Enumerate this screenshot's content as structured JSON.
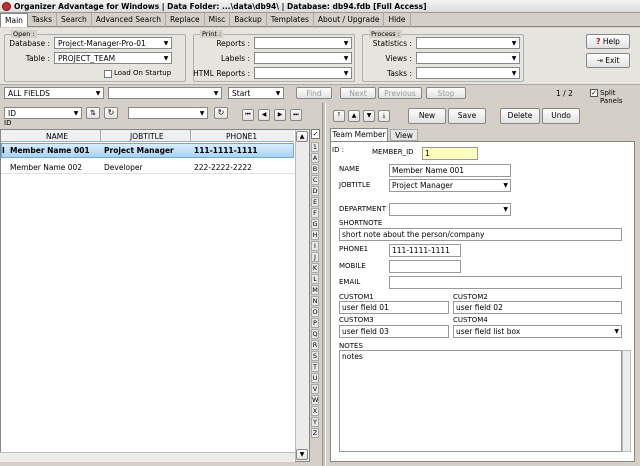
{
  "window": {
    "title": "Organizer Advantage for Windows | Data Folder: ...\\data\\db94\\ | Database: db94.fdb [Full Access]"
  },
  "tabs": [
    "Main",
    "Tasks",
    "Search",
    "Advanced Search",
    "Replace",
    "Misc",
    "Backup",
    "Templates",
    "About / Upgrade",
    "Hide"
  ],
  "open": {
    "group": "Open :",
    "database_label": "Database :",
    "database_value": "Project-Manager-Pro-01",
    "table_label": "Table :",
    "table_value": "PROJECT_TEAM",
    "load_on_startup": "Load On Startup"
  },
  "print": {
    "group": "Print :",
    "reports": "Reports :",
    "labels": "Labels :",
    "html_reports": "HTML Reports :"
  },
  "process": {
    "group": "Process :",
    "statistics": "Statistics :",
    "views": "Views :",
    "tasks": "Tasks :"
  },
  "help": {
    "help": "Help",
    "exit": "Exit"
  },
  "search": {
    "field": "ALL FIELDS",
    "value": "",
    "mode": "Start",
    "find": "Find",
    "next": "Next",
    "previous": "Previous",
    "stop": "Stop",
    "record_count": "1 / 2",
    "split_panels": "Split Panels"
  },
  "sort": {
    "field": "ID",
    "sub": "ID"
  },
  "grid": {
    "columns": [
      "NAME",
      "JOBTITLE",
      "PHONE1"
    ],
    "rows": [
      {
        "name": "Member Name 001",
        "jobtitle": "Project Manager",
        "phone": "111-1111-1111"
      },
      {
        "name": "Member Name 002",
        "jobtitle": "Developer",
        "phone": "222-2222-2222"
      }
    ],
    "indicator": "I"
  },
  "alphabet": [
    "1",
    "A",
    "B",
    "C",
    "D",
    "E",
    "F",
    "G",
    "H",
    "I",
    "J",
    "K",
    "L",
    "M",
    "N",
    "O",
    "P",
    "Q",
    "R",
    "S",
    "T",
    "U",
    "V",
    "W",
    "X",
    "Y",
    "Z"
  ],
  "record_buttons": {
    "new": "New",
    "save": "Save",
    "delete": "Delete",
    "undo": "Undo"
  },
  "form_tabs": [
    "Team Member",
    "View"
  ],
  "form": {
    "id_label": "ID :",
    "member_id_label": "MEMBER_ID",
    "member_id": "1",
    "name_label": "NAME",
    "name": "Member Name 001",
    "jobtitle_label": "JOBTITLE",
    "jobtitle": "Project Manager",
    "department_label": "DEPARTMENT",
    "department": "",
    "shortnote_label": "SHORTNOTE",
    "shortnote": "short note about the person/company",
    "phone1_label": "PHONE1",
    "phone1": "111-1111-1111",
    "mobile_label": "MOBILE",
    "mobile": "",
    "email_label": "EMAIL",
    "email": "",
    "custom1_label": "CUSTOM1",
    "custom1": "user field 01",
    "custom2_label": "CUSTOM2",
    "custom2": "user field 02",
    "custom3_label": "CUSTOM3",
    "custom3": "user field 03",
    "custom4_label": "CUSTOM4",
    "custom4": "user field list box",
    "notes_label": "NOTES",
    "notes": "notes"
  }
}
